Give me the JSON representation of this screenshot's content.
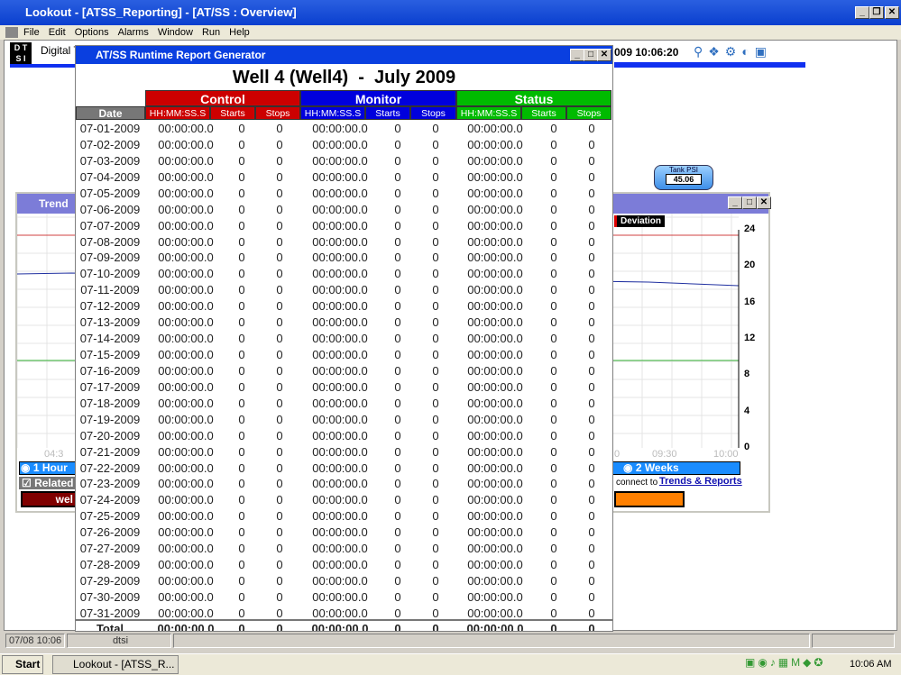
{
  "app": {
    "title": "Lookout - [ATSS_Reporting] - [AT/SS : Overview]",
    "menu": [
      "File",
      "Edit",
      "Options",
      "Alarms",
      "Window",
      "Run",
      "Help"
    ]
  },
  "overview": {
    "company": "Digital T",
    "datetime": "009 10:06:20",
    "tank_label": "Tank PSI",
    "tank_value": "45.06"
  },
  "trend": {
    "title": "Trend",
    "legend": "Deviation",
    "yticks": [
      "24",
      "20",
      "16",
      "12",
      "8",
      "4",
      "0"
    ],
    "xticks_left": "04:3",
    "xticks_right": [
      "0",
      "09:30",
      "10:00"
    ],
    "btn_1h": "1 Hour",
    "btn_2w": "2 Weeks",
    "related": "Related",
    "well_btn": "wel",
    "connect_text": "connect to",
    "link": "Trends & Reports",
    "colors": {
      "red": "#d04040",
      "blue": "#2030a0",
      "green": "#30b030"
    }
  },
  "report": {
    "window_title": "AT/SS Runtime Report Generator",
    "heading": "Well 4 (Well4)  -  July 2009",
    "groups": [
      {
        "label": "Control",
        "color": "#cc0000"
      },
      {
        "label": "Monitor",
        "color": "#0000dd"
      },
      {
        "label": "Status",
        "color": "#00bb00"
      }
    ],
    "date_header": "Date",
    "sub_headers": [
      "HH:MM:SS.S",
      "Starts",
      "Stops"
    ],
    "rows": [
      [
        "07-01-2009",
        "00:00:00.0",
        "0",
        "0",
        "00:00:00.0",
        "0",
        "0",
        "00:00:00.0",
        "0",
        "0"
      ],
      [
        "07-02-2009",
        "00:00:00.0",
        "0",
        "0",
        "00:00:00.0",
        "0",
        "0",
        "00:00:00.0",
        "0",
        "0"
      ],
      [
        "07-03-2009",
        "00:00:00.0",
        "0",
        "0",
        "00:00:00.0",
        "0",
        "0",
        "00:00:00.0",
        "0",
        "0"
      ],
      [
        "07-04-2009",
        "00:00:00.0",
        "0",
        "0",
        "00:00:00.0",
        "0",
        "0",
        "00:00:00.0",
        "0",
        "0"
      ],
      [
        "07-05-2009",
        "00:00:00.0",
        "0",
        "0",
        "00:00:00.0",
        "0",
        "0",
        "00:00:00.0",
        "0",
        "0"
      ],
      [
        "07-06-2009",
        "00:00:00.0",
        "0",
        "0",
        "00:00:00.0",
        "0",
        "0",
        "00:00:00.0",
        "0",
        "0"
      ],
      [
        "07-07-2009",
        "00:00:00.0",
        "0",
        "0",
        "00:00:00.0",
        "0",
        "0",
        "00:00:00.0",
        "0",
        "0"
      ],
      [
        "07-08-2009",
        "00:00:00.0",
        "0",
        "0",
        "00:00:00.0",
        "0",
        "0",
        "00:00:00.0",
        "0",
        "0"
      ],
      [
        "07-09-2009",
        "00:00:00.0",
        "0",
        "0",
        "00:00:00.0",
        "0",
        "0",
        "00:00:00.0",
        "0",
        "0"
      ],
      [
        "07-10-2009",
        "00:00:00.0",
        "0",
        "0",
        "00:00:00.0",
        "0",
        "0",
        "00:00:00.0",
        "0",
        "0"
      ],
      [
        "07-11-2009",
        "00:00:00.0",
        "0",
        "0",
        "00:00:00.0",
        "0",
        "0",
        "00:00:00.0",
        "0",
        "0"
      ],
      [
        "07-12-2009",
        "00:00:00.0",
        "0",
        "0",
        "00:00:00.0",
        "0",
        "0",
        "00:00:00.0",
        "0",
        "0"
      ],
      [
        "07-13-2009",
        "00:00:00.0",
        "0",
        "0",
        "00:00:00.0",
        "0",
        "0",
        "00:00:00.0",
        "0",
        "0"
      ],
      [
        "07-14-2009",
        "00:00:00.0",
        "0",
        "0",
        "00:00:00.0",
        "0",
        "0",
        "00:00:00.0",
        "0",
        "0"
      ],
      [
        "07-15-2009",
        "00:00:00.0",
        "0",
        "0",
        "00:00:00.0",
        "0",
        "0",
        "00:00:00.0",
        "0",
        "0"
      ],
      [
        "07-16-2009",
        "00:00:00.0",
        "0",
        "0",
        "00:00:00.0",
        "0",
        "0",
        "00:00:00.0",
        "0",
        "0"
      ],
      [
        "07-17-2009",
        "00:00:00.0",
        "0",
        "0",
        "00:00:00.0",
        "0",
        "0",
        "00:00:00.0",
        "0",
        "0"
      ],
      [
        "07-18-2009",
        "00:00:00.0",
        "0",
        "0",
        "00:00:00.0",
        "0",
        "0",
        "00:00:00.0",
        "0",
        "0"
      ],
      [
        "07-19-2009",
        "00:00:00.0",
        "0",
        "0",
        "00:00:00.0",
        "0",
        "0",
        "00:00:00.0",
        "0",
        "0"
      ],
      [
        "07-20-2009",
        "00:00:00.0",
        "0",
        "0",
        "00:00:00.0",
        "0",
        "0",
        "00:00:00.0",
        "0",
        "0"
      ],
      [
        "07-21-2009",
        "00:00:00.0",
        "0",
        "0",
        "00:00:00.0",
        "0",
        "0",
        "00:00:00.0",
        "0",
        "0"
      ],
      [
        "07-22-2009",
        "00:00:00.0",
        "0",
        "0",
        "00:00:00.0",
        "0",
        "0",
        "00:00:00.0",
        "0",
        "0"
      ],
      [
        "07-23-2009",
        "00:00:00.0",
        "0",
        "0",
        "00:00:00.0",
        "0",
        "0",
        "00:00:00.0",
        "0",
        "0"
      ],
      [
        "07-24-2009",
        "00:00:00.0",
        "0",
        "0",
        "00:00:00.0",
        "0",
        "0",
        "00:00:00.0",
        "0",
        "0"
      ],
      [
        "07-25-2009",
        "00:00:00.0",
        "0",
        "0",
        "00:00:00.0",
        "0",
        "0",
        "00:00:00.0",
        "0",
        "0"
      ],
      [
        "07-26-2009",
        "00:00:00.0",
        "0",
        "0",
        "00:00:00.0",
        "0",
        "0",
        "00:00:00.0",
        "0",
        "0"
      ],
      [
        "07-27-2009",
        "00:00:00.0",
        "0",
        "0",
        "00:00:00.0",
        "0",
        "0",
        "00:00:00.0",
        "0",
        "0"
      ],
      [
        "07-28-2009",
        "00:00:00.0",
        "0",
        "0",
        "00:00:00.0",
        "0",
        "0",
        "00:00:00.0",
        "0",
        "0"
      ],
      [
        "07-29-2009",
        "00:00:00.0",
        "0",
        "0",
        "00:00:00.0",
        "0",
        "0",
        "00:00:00.0",
        "0",
        "0"
      ],
      [
        "07-30-2009",
        "00:00:00.0",
        "0",
        "0",
        "00:00:00.0",
        "0",
        "0",
        "00:00:00.0",
        "0",
        "0"
      ],
      [
        "07-31-2009",
        "00:00:00.0",
        "0",
        "0",
        "00:00:00.0",
        "0",
        "0",
        "00:00:00.0",
        "0",
        "0"
      ]
    ],
    "total": [
      "Total",
      "00:00:00.0",
      "0",
      "0",
      "00:00:00.0",
      "0",
      "0",
      "00:00:00.0",
      "0",
      "0"
    ]
  },
  "statusbar": {
    "time": "07/08 10:06",
    "user": "dtsi"
  },
  "taskbar": {
    "start": "Start",
    "task": "Lookout - [ATSS_R...",
    "clock": "10:06 AM"
  }
}
